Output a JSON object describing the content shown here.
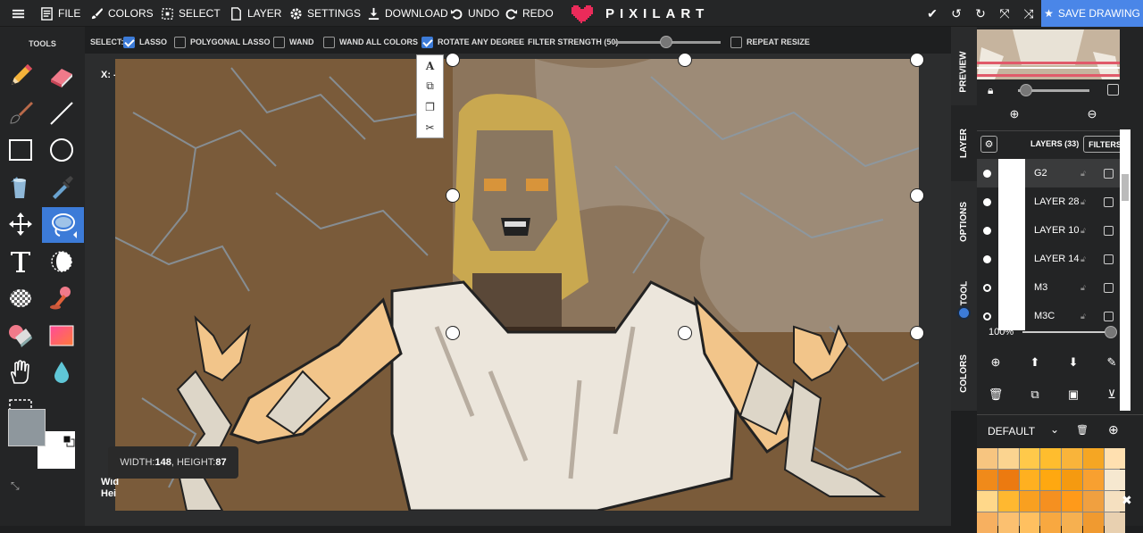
{
  "topbar": {
    "file": "FILE",
    "colors": "COLORS",
    "select": "SELECT",
    "layer": "LAYER",
    "settings": "SETTINGS",
    "download": "DOWNLOAD",
    "undo": "UNDO",
    "redo": "REDO",
    "logo": "PIXILART",
    "save": "SAVE DRAWING"
  },
  "tools": {
    "label": "TOOLS"
  },
  "options": {
    "select_label": "SELECT:",
    "lasso": "LASSO",
    "lasso_checked": true,
    "polygon_lasso": "POLYGONAL LASSO",
    "polygon_lasso_checked": false,
    "wand": "WAND",
    "wand_checked": false,
    "wand_all": "WAND ALL COLORS",
    "wand_all_checked": false,
    "rotate_any": "ROTATE ANY DEGREE",
    "rotate_any_checked": true,
    "filter_strength": "FILTER STRENGTH (50)",
    "filter_value": 50,
    "repeat_resize": "REPEAT RESIZE",
    "repeat_resize_checked": false
  },
  "canvas": {
    "x_label": "X: -",
    "w_label_1": "Wid",
    "w_label_2": "Hei",
    "tooltip_width_label": "WIDTH: ",
    "tooltip_width": "148",
    "tooltip_height_label": ", HEIGHT: ",
    "tooltip_height": "87"
  },
  "sidetabs": {
    "preview": "PREVIEW",
    "layer": "LAYER",
    "options": "OPTIONS",
    "tool": "TOOL",
    "colors": "COLORS"
  },
  "layers": {
    "title": "LAYERS (33)",
    "filters": "FILTERS",
    "items": [
      {
        "name": "G2",
        "dot": "filled"
      },
      {
        "name": "LAYER 28",
        "dot": "filled"
      },
      {
        "name": "LAYER 10",
        "dot": "filled"
      },
      {
        "name": "LAYER 14",
        "dot": "filled"
      },
      {
        "name": "M3",
        "dot": "hollow"
      },
      {
        "name": "M3C",
        "dot": "hollow"
      }
    ],
    "opacity": "100%"
  },
  "palette": {
    "name": "DEFAULT",
    "colors": [
      "#f7c580",
      "#fbd490",
      "#ffc94a",
      "#ffbd2e",
      "#f9b43a",
      "#f5a623",
      "#ffe0b0",
      "#f08a1a",
      "#ec7a10",
      "#ffb020",
      "#ffa810",
      "#f59a10",
      "#f8a030",
      "#f6e8d0",
      "#ffd88a",
      "#ffb830",
      "#f9a020",
      "#f59020",
      "#ff9a1a",
      "#f0a040",
      "#f5e0c0",
      "#f7b060",
      "#fbc070",
      "#ffc060",
      "#f8a840",
      "#f6b050",
      "#f09a30",
      "#e8d0b0"
    ]
  },
  "colors": {
    "primary": "#8e979d",
    "secondary": "#ffffff",
    "accent": "#4a86e8"
  }
}
